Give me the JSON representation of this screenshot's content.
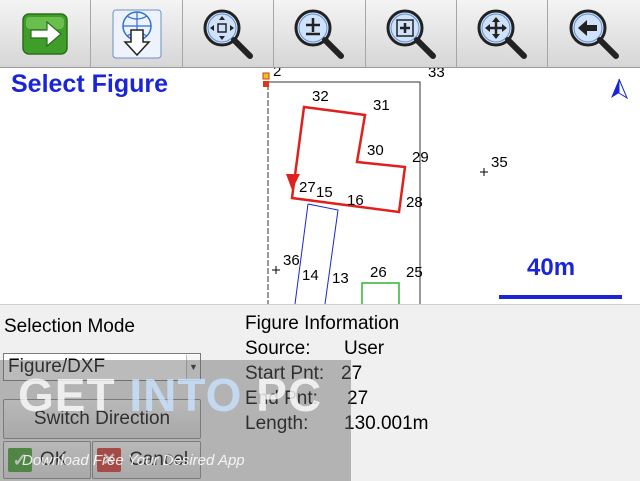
{
  "toolbar": {
    "buttons": [
      {
        "icon": "arrow-right-icon",
        "accent": "#3f9d2a"
      },
      {
        "icon": "download-globe-icon",
        "accent": "#2f6fd6"
      },
      {
        "icon": "zoom-extents-icon",
        "accent": "#2f6fd6"
      },
      {
        "icon": "zoom-in-out-icon",
        "accent": "#2f6fd6"
      },
      {
        "icon": "zoom-window-icon",
        "accent": "#2f6fd6"
      },
      {
        "icon": "pan-icon",
        "accent": "#2f6fd6"
      },
      {
        "icon": "back-icon",
        "accent": "#2f6fd6"
      }
    ]
  },
  "map": {
    "title": "Select Figure",
    "scale_label": "40m",
    "north_icon": "north-arrow-icon",
    "colors": {
      "selected": "#e0201c",
      "line": "#1a25d8",
      "green": "#2fb52f"
    },
    "points": [
      {
        "id": "p2",
        "label": "2"
      },
      {
        "id": "p33",
        "label": "33"
      },
      {
        "id": "p32",
        "label": "32"
      },
      {
        "id": "p31",
        "label": "31"
      },
      {
        "id": "p30",
        "label": "30"
      },
      {
        "id": "p29",
        "label": "29"
      },
      {
        "id": "p35",
        "label": "35"
      },
      {
        "id": "p27",
        "label": "27"
      },
      {
        "id": "p15",
        "label": "15"
      },
      {
        "id": "p16",
        "label": "16"
      },
      {
        "id": "p28",
        "label": "28"
      },
      {
        "id": "p36",
        "label": "36"
      },
      {
        "id": "p14",
        "label": "14"
      },
      {
        "id": "p13",
        "label": "13"
      },
      {
        "id": "p26",
        "label": "26"
      },
      {
        "id": "p25",
        "label": "25"
      }
    ]
  },
  "panel": {
    "selection_mode_label": "Selection Mode",
    "selection_mode_value": "Figure/DXF",
    "switch_direction_label": "Switch Direction",
    "ok_label": "OK",
    "cancel_label": "Cancel",
    "info": {
      "heading": "Figure Information",
      "source_label": "Source:",
      "source_value": "User",
      "start_label": "Start Pnt:",
      "start_value": "27",
      "end_label": "End Pnt:",
      "end_value": "27",
      "length_label": "Length:",
      "length_value": "130.001m"
    }
  },
  "watermark": {
    "main_1": "GET ",
    "main_2": "INTO",
    "main_3": " PC",
    "sub": "Download Free Your Desired App"
  }
}
